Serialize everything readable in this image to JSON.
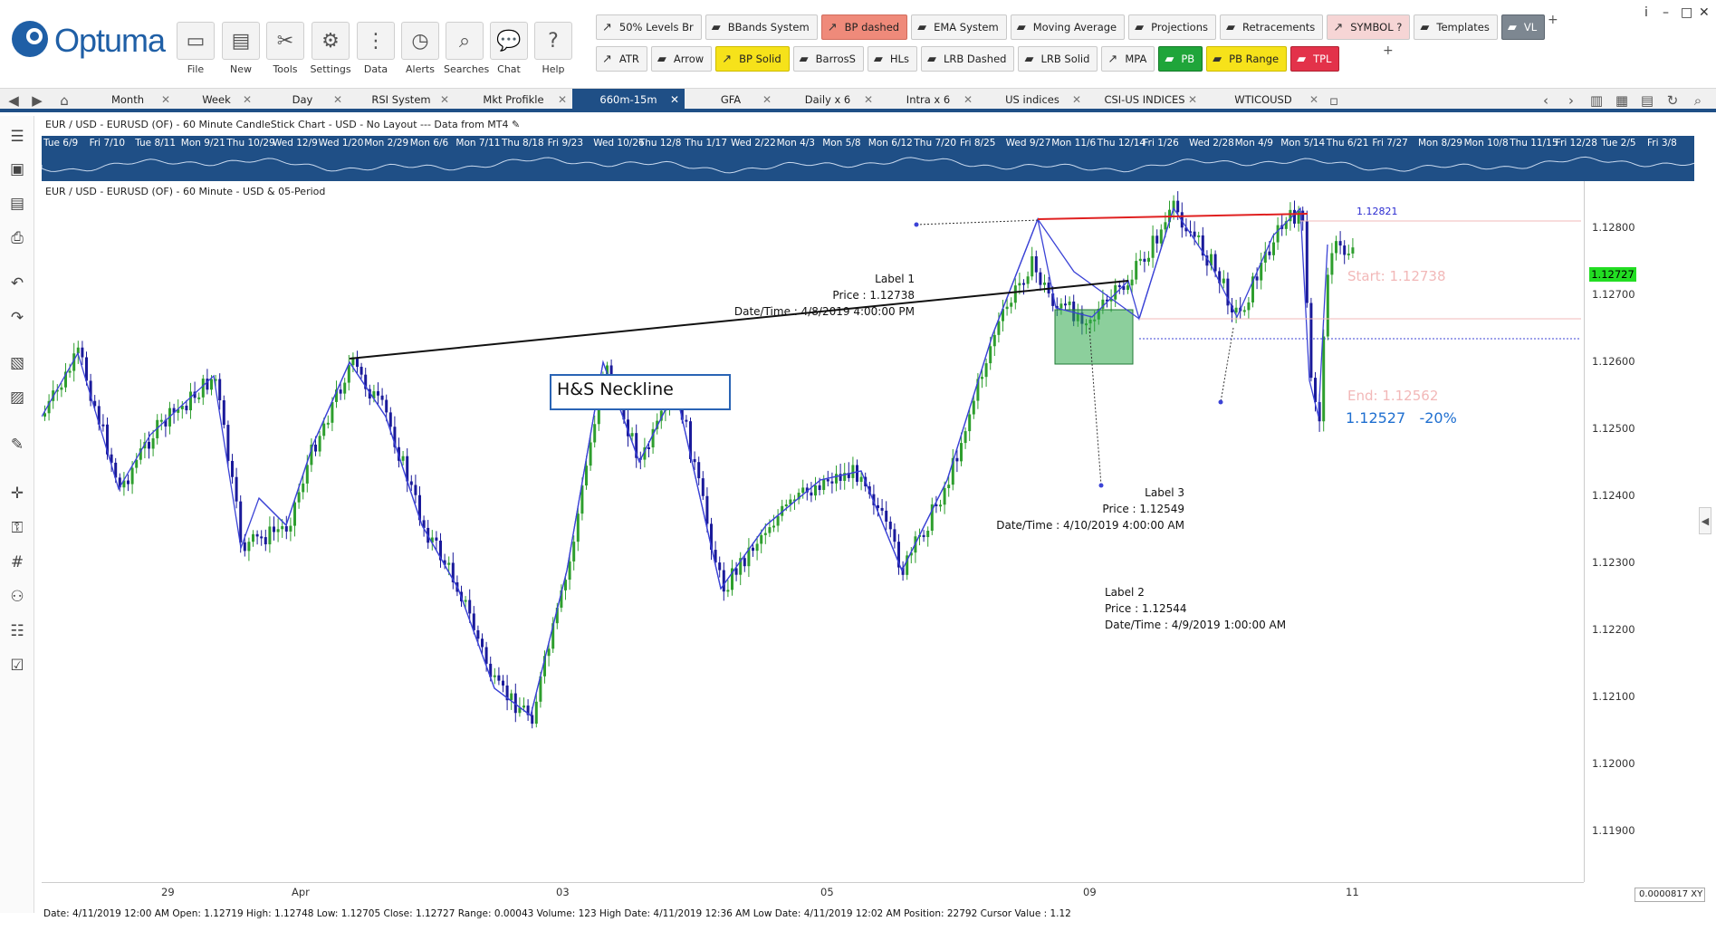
{
  "app": {
    "logo_text": "Optuma"
  },
  "main_buttons": [
    {
      "label": "File",
      "icon": "folder-icon"
    },
    {
      "label": "New",
      "icon": "new-chart-icon"
    },
    {
      "label": "Tools",
      "icon": "tools-icon"
    },
    {
      "label": "Settings",
      "icon": "gear-icon"
    },
    {
      "label": "Data",
      "icon": "data-binary-icon"
    },
    {
      "label": "Alerts",
      "icon": "alarm-clock-icon"
    },
    {
      "label": "Searches",
      "icon": "magnifier-icon"
    },
    {
      "label": "Chat",
      "icon": "chat-bubble-icon"
    },
    {
      "label": "Help",
      "icon": "question-icon"
    }
  ],
  "toolbar_row1": [
    {
      "label": "50% Levels Br",
      "style": "normal"
    },
    {
      "label": "BBands System",
      "style": "normal"
    },
    {
      "label": "BP dashed",
      "style": "red"
    },
    {
      "label": "EMA System",
      "style": "normal"
    },
    {
      "label": "Moving Average",
      "style": "normal"
    },
    {
      "label": "Projections",
      "style": "normal"
    },
    {
      "label": "Retracements",
      "style": "normal"
    },
    {
      "label": "SYMBOL ?",
      "style": "pink"
    },
    {
      "label": "Templates",
      "style": "normal"
    },
    {
      "label": "VL",
      "style": "grey"
    }
  ],
  "toolbar_row2": [
    {
      "label": "ATR",
      "style": "normal"
    },
    {
      "label": "Arrow",
      "style": "normal"
    },
    {
      "label": "BP Solid",
      "style": "yellow"
    },
    {
      "label": "BarrosS",
      "style": "normal"
    },
    {
      "label": "HLs",
      "style": "normal"
    },
    {
      "label": "LRB Dashed",
      "style": "normal"
    },
    {
      "label": "LRB Solid",
      "style": "normal"
    },
    {
      "label": "MPA",
      "style": "normal"
    },
    {
      "label": "PB",
      "style": "green"
    },
    {
      "label": "PB Range",
      "style": "yellow"
    },
    {
      "label": "TPL",
      "style": "crimson"
    }
  ],
  "plus_sign": "+",
  "window_controls": {
    "info": "i",
    "min": "–",
    "max": "□",
    "close": "✕"
  },
  "tabs": [
    {
      "label": "Month",
      "active": false
    },
    {
      "label": "Week",
      "active": false
    },
    {
      "label": "Day",
      "active": false
    },
    {
      "label": "RSI System",
      "active": false
    },
    {
      "label": "Mkt Profikle",
      "active": false
    },
    {
      "label": "660m-15m",
      "active": true
    },
    {
      "label": "GFA",
      "active": false
    },
    {
      "label": "Daily x 6",
      "active": false
    },
    {
      "label": "Intra x 6",
      "active": false
    },
    {
      "label": "US indices",
      "active": false
    },
    {
      "label": "CSI-US INDICES",
      "active": false
    },
    {
      "label": "WTICOUSD",
      "active": false
    }
  ],
  "chart": {
    "header": "EUR / USD - EURUSD (OF) - 60 Minute CandleStick Chart - USD - No Layout --- Data from MT4",
    "subheader": "EUR / USD - EURUSD (OF) - 60 Minute - USD & 05-Period",
    "overview_dates": [
      "Tue 6/9",
      "Fri 7/10",
      "Tue 8/11",
      "Mon 9/21",
      "Thu 10/29",
      "Wed 12/9",
      "Wed 1/20",
      "Mon 2/29",
      "Mon 6/6",
      "Mon 7/11",
      "Thu 8/18",
      "Fri 9/23",
      "Wed 10/26",
      "Thu 12/8",
      "Thu 1/17",
      "Wed 2/22",
      "Mon 4/3",
      "Mon 5/8",
      "Mon 6/12",
      "Thu 7/20",
      "Fri 8/25",
      "Wed 9/27",
      "Mon 11/6",
      "Thu 12/14",
      "Fri 1/26",
      "Wed 2/28",
      "Mon 4/9",
      "Mon 5/14",
      "Thu 6/21",
      "Fri 7/27",
      "Mon 8/29",
      "Mon 10/8",
      "Thu 11/15",
      "Fri 12/28",
      "Tue 2/5",
      "Fri 3/8"
    ],
    "price_ticks": [
      "1.12800",
      "1.12700",
      "1.12600",
      "1.12500",
      "1.12400",
      "1.12300",
      "1.12200",
      "1.12100",
      "1.12000",
      "1.11900"
    ],
    "last_price": "1.12727",
    "time_ticks": [
      "29",
      "Apr",
      "03",
      "05",
      "09",
      "11"
    ],
    "high_marker": "1.12821",
    "neckline_label": "H&S Neckline",
    "label1": {
      "title": "Label 1",
      "price": "Price : 1.12738",
      "datetime": "Date/Time : 4/8/2019 4:00:00 PM"
    },
    "label2": {
      "title": "Label 2",
      "price": "Price : 1.12544",
      "datetime": "Date/Time : 4/9/2019 1:00:00 AM"
    },
    "label3": {
      "title": "Label 3",
      "price": "Price : 1.12549",
      "datetime": "Date/Time : 4/10/2019 4:00:00 AM"
    },
    "fib_start": "Start: 1.12738",
    "fib_end": "End: 1.12562",
    "fib_level": "1.12527",
    "fib_pct": "-20%",
    "scale_value": "0.0000817",
    "scale_unit": "XY"
  },
  "status_bar": "Date: 4/11/2019 12:00 AM Open: 1.12719 High: 1.12748 Low: 1.12705 Close: 1.12727 Range: 0.00043 Volume: 123 High Date: 4/11/2019 12:36 AM Low Date: 4/11/2019 12:02 AM Position: 22792 Cursor Value : 1.12",
  "colors": {
    "accent": "#1f4f86",
    "bull": "#2e9e2e",
    "bear": "#1a1a9a",
    "zigzag": "#3b43d6",
    "neckline": "#111111",
    "resistance": "#e02020",
    "last_price_bg": "#22dd22"
  }
}
